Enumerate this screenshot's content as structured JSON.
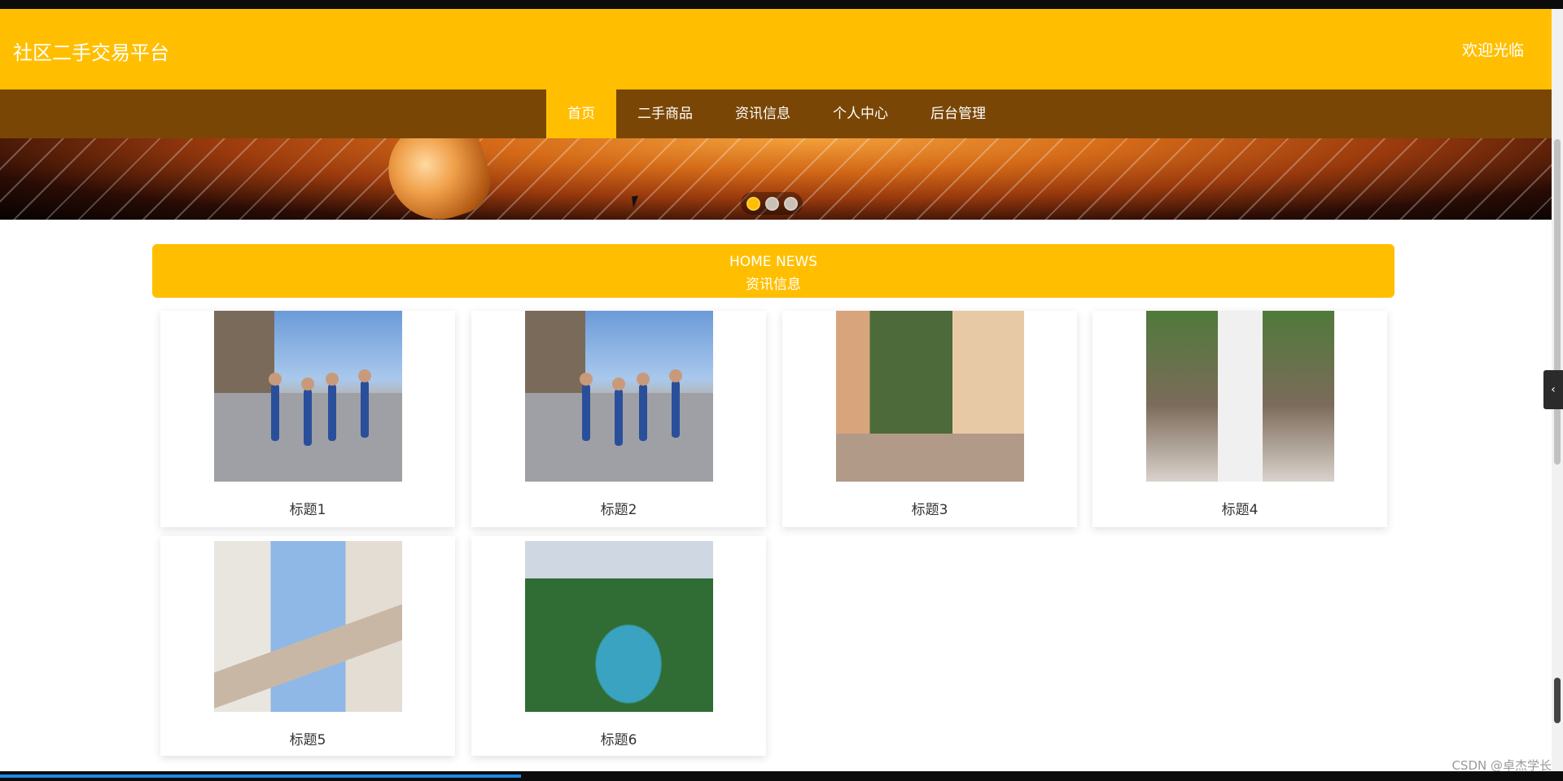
{
  "header": {
    "site_title": "社区二手交易平台",
    "welcome": "欢迎光临"
  },
  "nav": {
    "items": [
      {
        "label": "首页",
        "active": true
      },
      {
        "label": "二手商品",
        "active": false
      },
      {
        "label": "资讯信息",
        "active": false
      },
      {
        "label": "个人中心",
        "active": false
      },
      {
        "label": "后台管理",
        "active": false
      }
    ]
  },
  "banner": {
    "slide_count": 3,
    "active_slide": 1
  },
  "news_section": {
    "title_en": "HOME NEWS",
    "title_cn": "资讯信息",
    "items": [
      {
        "title": "标题1"
      },
      {
        "title": "标题2"
      },
      {
        "title": "标题3"
      },
      {
        "title": "标题4"
      },
      {
        "title": "标题5"
      },
      {
        "title": "标题6"
      }
    ]
  },
  "footer": {
    "watermark": "CSDN @卓杰学长"
  },
  "colors": {
    "primary": "#ffbf00",
    "nav_bg": "#7a4606"
  },
  "icons": {
    "side_toggle": "chevron-left-icon"
  }
}
